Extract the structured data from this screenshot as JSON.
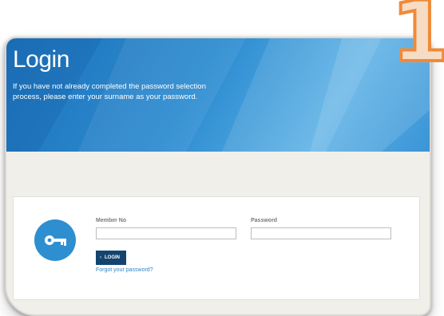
{
  "banner": {
    "title": "Login",
    "intro": "If you have not already completed the password selection process, please enter your surname as your password."
  },
  "form": {
    "member_no_label": "Member No",
    "member_no_value": "",
    "password_label": "Password",
    "password_value": "",
    "login_label": "LOGIN",
    "forgot_label": "Forgot your password?",
    "key_icon": "key-icon"
  },
  "badge": {
    "number": "1"
  },
  "colors": {
    "banner_blue": "#2c8bd0",
    "button_navy": "#14456f",
    "link_blue": "#2f86c8",
    "badge_orange": "#ef8a3a"
  }
}
